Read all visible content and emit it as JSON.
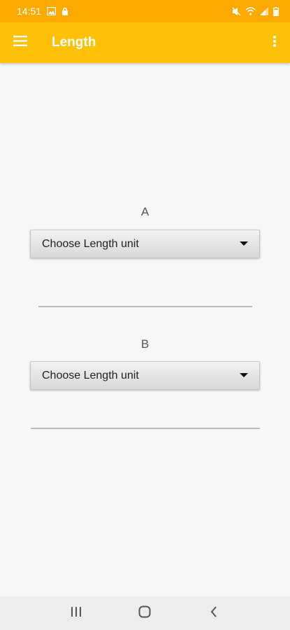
{
  "status_bar": {
    "time": "14:51",
    "icons": [
      "image-icon",
      "lock-icon",
      "mute-icon",
      "wifi-icon",
      "signal-icon",
      "battery-icon"
    ]
  },
  "app_bar": {
    "title": "Length",
    "menu_icon": "hamburger-menu-icon",
    "overflow_icon": "more-vert-icon",
    "color": "#ffc107",
    "status_color": "#fdaa00"
  },
  "field_a": {
    "label": "A",
    "select_value": "Choose Length unit",
    "input_value": ""
  },
  "field_b": {
    "label": "B",
    "select_value": "Choose Length unit",
    "input_value": ""
  },
  "nav": {
    "recents_icon": "recent-apps-icon",
    "home_icon": "home-icon",
    "back_icon": "back-icon"
  }
}
